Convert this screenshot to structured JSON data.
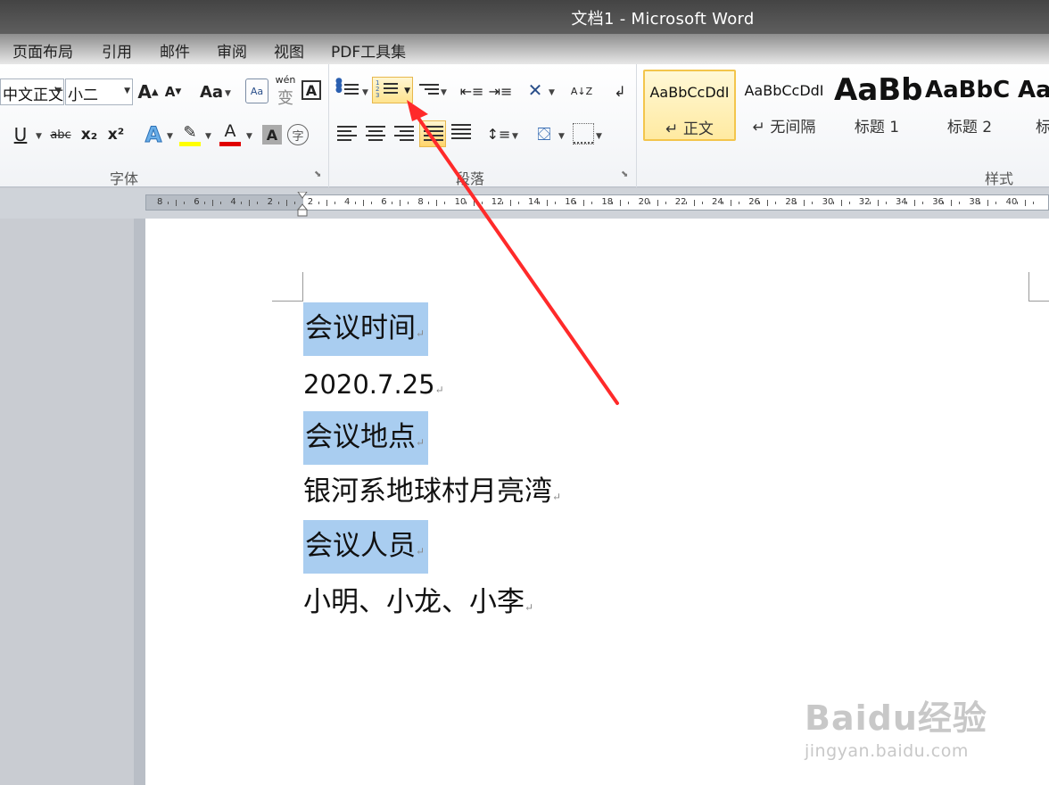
{
  "window": {
    "title": "文档1 - Microsoft Word"
  },
  "tabs": [
    "页面布局",
    "引用",
    "邮件",
    "审阅",
    "视图",
    "PDF工具集"
  ],
  "ribbon": {
    "font_group": {
      "label": "字体",
      "font_name": "中文正文",
      "font_size": "小二",
      "grow_font": "A",
      "shrink_font": "A",
      "change_case": "Aa",
      "phonetic": "wén",
      "char_border": "A",
      "underline": "U",
      "strikethrough": "abc",
      "subscript": "x₂",
      "superscript": "x²",
      "text_effect": "A",
      "font_color": "A",
      "char_shading": "A",
      "enclose": "字",
      "highlight_color": "#ffff00",
      "font_color_value": "#e00000"
    },
    "paragraph_group": {
      "label": "段落",
      "sort": "A↓Z"
    },
    "styles_group": {
      "label": "样式",
      "items": [
        {
          "preview": "AaBbCcDdI",
          "name": "↵ 正文",
          "selected": true
        },
        {
          "preview": "AaBbCcDdI",
          "name": "↵ 无间隔",
          "selected": false
        },
        {
          "preview": "AaBb",
          "name": "标题 1",
          "selected": false
        },
        {
          "preview": "AaBbC",
          "name": "标题 2",
          "selected": false
        },
        {
          "preview": "Aa",
          "name": "标",
          "selected": false
        }
      ]
    }
  },
  "ruler": {
    "labels": [
      "8",
      "6",
      "4",
      "2",
      "2",
      "4",
      "6",
      "8",
      "10",
      "12",
      "14",
      "16",
      "18",
      "20",
      "22",
      "24",
      "26",
      "28",
      "30",
      "32",
      "34",
      "36",
      "38",
      "40"
    ]
  },
  "document": {
    "paragraphs": [
      {
        "text": "会议时间",
        "highlighted": true
      },
      {
        "text": "2020.7.25",
        "highlighted": false
      },
      {
        "text": "会议地点",
        "highlighted": true
      },
      {
        "text": "银河系地球村月亮湾",
        "highlighted": false
      },
      {
        "text": "会议人员",
        "highlighted": true
      },
      {
        "text": "小明、小龙、小李",
        "highlighted": false
      }
    ],
    "paragraph_mark": "↵",
    "selection_color": "#a9cdf0"
  },
  "watermark": {
    "logo": "Baidu经验",
    "url": "jingyan.baidu.com"
  },
  "annotation": {
    "arrow_color": "#ff2a2a"
  }
}
